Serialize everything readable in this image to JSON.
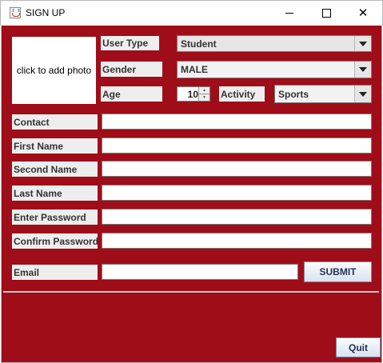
{
  "window": {
    "title": "SIGN UP",
    "icon": "java-cup-icon",
    "controls": [
      "minimize-icon",
      "maximize-icon",
      "close-icon"
    ]
  },
  "colors": {
    "background": "#9f0d19",
    "label_bg": "#eeeeee",
    "field_bg": "#ffffff",
    "button_text": "#223355"
  },
  "photo": {
    "label": "click to add photo"
  },
  "user_type": {
    "label": "User Type",
    "value": "Student"
  },
  "gender": {
    "label": "Gender",
    "value": "MALE"
  },
  "age": {
    "label": "Age",
    "value": "10"
  },
  "activity": {
    "label": "Activity",
    "value": "Sports"
  },
  "contact": {
    "label": "Contact",
    "value": ""
  },
  "first_name": {
    "label": "First Name",
    "value": ""
  },
  "second_name": {
    "label": "Second Name",
    "value": ""
  },
  "last_name": {
    "label": "Last Name",
    "value": ""
  },
  "enter_password": {
    "label": "Enter Password",
    "value": ""
  },
  "confirm_password": {
    "label": "Confirm Password",
    "value": ""
  },
  "email": {
    "label": "Email",
    "value": ""
  },
  "buttons": {
    "submit": "SUBMIT",
    "quit": "Quit"
  }
}
